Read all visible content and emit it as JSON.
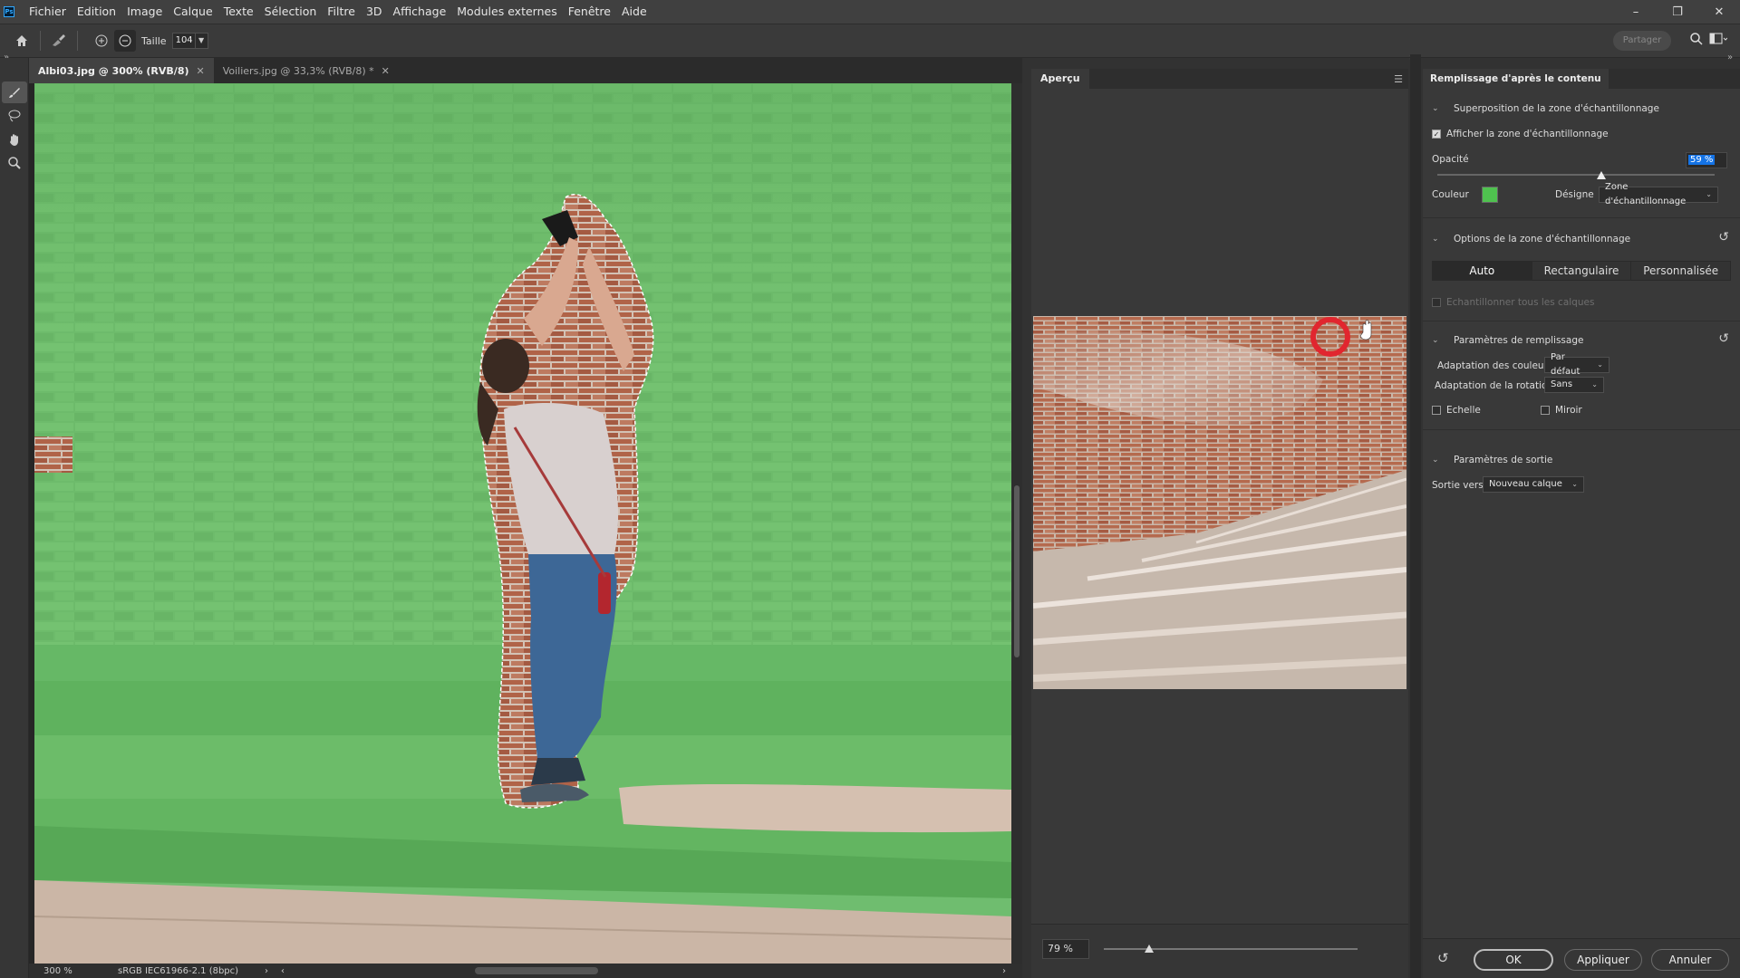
{
  "app": {
    "logo": "Ps",
    "menu": [
      "Fichier",
      "Edition",
      "Image",
      "Calque",
      "Texte",
      "Sélection",
      "Filtre",
      "3D",
      "Affichage",
      "Modules externes",
      "Fenêtre",
      "Aide"
    ],
    "window_controls": [
      "minimize-icon",
      "restore-icon",
      "close-icon"
    ]
  },
  "options": {
    "size_label": "Taille",
    "size_value": "104",
    "share_label": "Partager"
  },
  "tabs": [
    {
      "label": "Albi03.jpg @ 300% (RVB/8)",
      "active": true
    },
    {
      "label": "Voiliers.jpg @ 33,3% (RVB/8) *",
      "active": false
    }
  ],
  "status": {
    "zoom": "300 %",
    "profile": "sRGB IEC61966-2.1 (8bpc)"
  },
  "preview": {
    "tab": "Aperçu",
    "zoom": "79 %",
    "zoom_fraction": 0.18
  },
  "props": {
    "tab": "Remplissage d'après le contenu",
    "sampling_overlay": {
      "title": "Superposition de la zone d'échantillonnage",
      "show_label": "Afficher la zone d'échantillonnage",
      "show_checked": true,
      "opacity_label": "Opacité",
      "opacity_value": "59 %",
      "opacity_fraction": 0.59,
      "color_label": "Couleur",
      "color": "#4fc24f",
      "indicates_label": "Désigne",
      "indicates_value": "Zone d'échantillonnage"
    },
    "sampling_options": {
      "title": "Options de la zone d'échantillonnage",
      "modes": [
        "Auto",
        "Rectangulaire",
        "Personnalisée"
      ],
      "active_mode": "Auto",
      "sample_all_label": "Echantillonner tous les calques"
    },
    "fill_settings": {
      "title": "Paramètres de remplissage",
      "color_adapt_label": "Adaptation des couleurs",
      "color_adapt_value": "Par défaut",
      "rotation_adapt_label": "Adaptation de la rotation",
      "rotation_adapt_value": "Sans",
      "scale_label": "Echelle",
      "mirror_label": "Miroir"
    },
    "output": {
      "title": "Paramètres de sortie",
      "output_to_label": "Sortie vers",
      "output_to_value": "Nouveau calque"
    },
    "buttons": {
      "ok": "OK",
      "apply": "Appliquer",
      "cancel": "Annuler"
    }
  },
  "colors": {
    "accent": "#1473e6",
    "overlay_green": "#4fc24f",
    "panel_bg": "#393939"
  }
}
